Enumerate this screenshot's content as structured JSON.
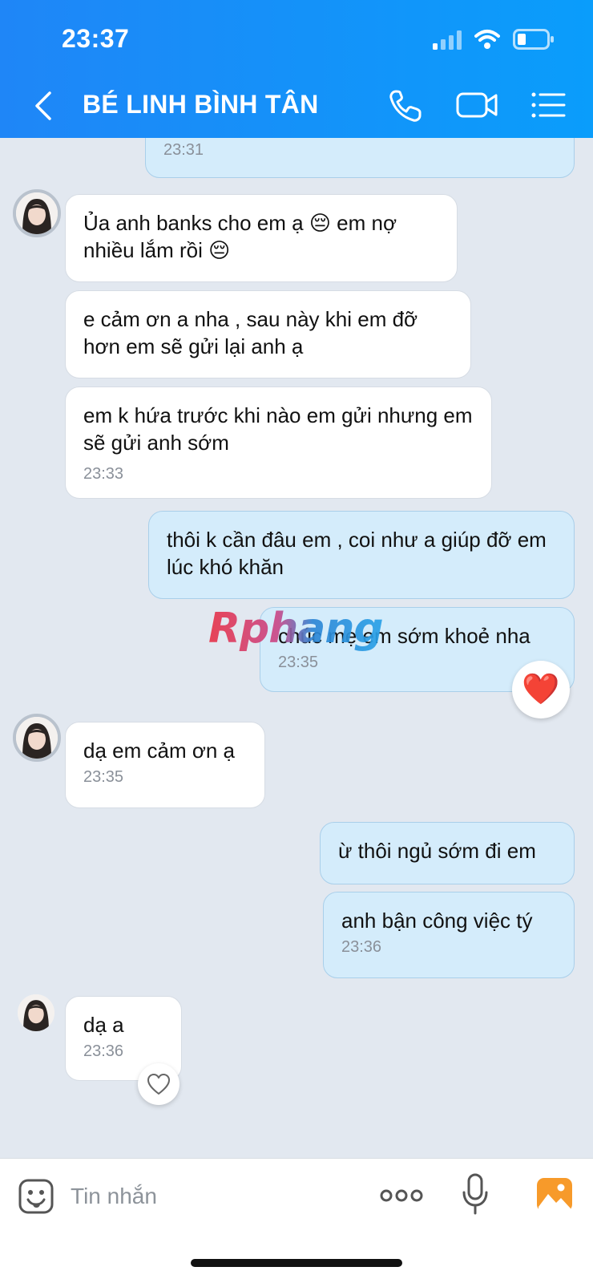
{
  "status_bar": {
    "time": "23:37"
  },
  "header": {
    "title": "BÉ LINH BÌNH TÂN",
    "back_icon": "chevron-left-icon",
    "call_icon": "phone-icon",
    "video_icon": "video-camera-icon",
    "menu_icon": "list-menu-icon"
  },
  "messages": [
    {
      "direction": "out",
      "time": "23:31"
    },
    {
      "direction": "in",
      "text": "Ủa anh banks cho em ạ 😔 em nợ nhiều lắm rồi 😔"
    },
    {
      "direction": "in",
      "text": "e cảm ơn a nha , sau này khi em đỡ hơn em sẽ gửi lại anh ạ"
    },
    {
      "direction": "in",
      "text": "em k hứa trước khi nào em gửi nhưng em sẽ gửi anh sớm",
      "time": "23:33"
    },
    {
      "direction": "out",
      "text": "thôi k cần đâu em , coi như a giúp đỡ em lúc khó khăn"
    },
    {
      "direction": "out",
      "text": "chúc mẹ em sớm khoẻ nha",
      "time": "23:35",
      "reaction": "❤️"
    },
    {
      "direction": "in",
      "text": "dạ em cảm ơn ạ",
      "time": "23:35"
    },
    {
      "direction": "out",
      "text": "ừ thôi ngủ sớm đi em"
    },
    {
      "direction": "out",
      "text": "anh bận công việc tý",
      "time": "23:36"
    },
    {
      "direction": "in",
      "text": "dạ a",
      "time": "23:36"
    }
  ],
  "watermark": "Rphang",
  "composer": {
    "placeholder": "Tin nhắn",
    "emoji_icon": "sticker-face-icon",
    "more_icon": "more-dots-icon",
    "mic_icon": "microphone-icon",
    "image_icon": "image-gallery-icon"
  },
  "colors": {
    "header": "#1f86f7",
    "outgoing_bubble": "#d4ecfb",
    "incoming_bubble": "#ffffff",
    "background": "#e2e8f0",
    "image_button": "#f79a2a"
  }
}
